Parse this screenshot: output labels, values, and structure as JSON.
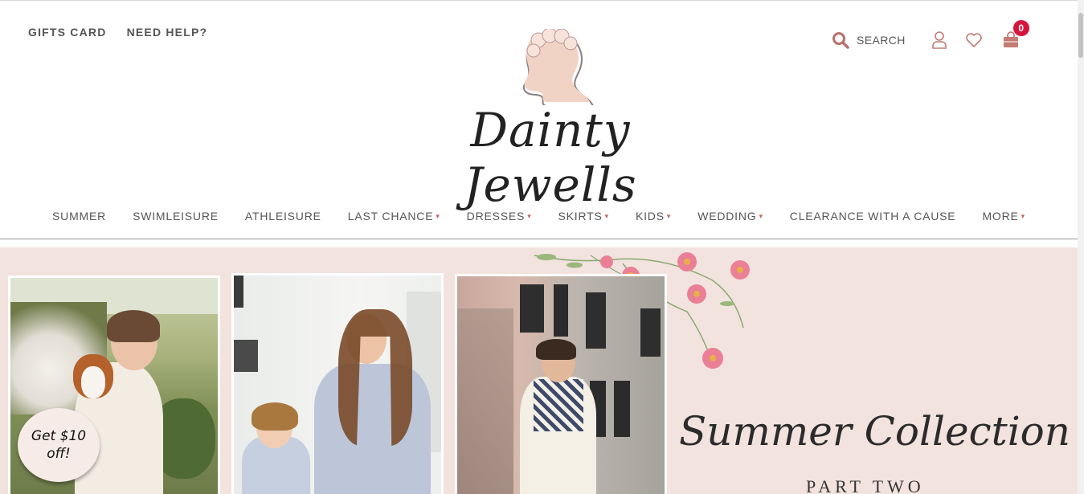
{
  "header": {
    "util_links": [
      "GIFTS CARD",
      "NEED HELP?"
    ],
    "logo_text": "Dainty Jewells",
    "search_label": "SEARCH",
    "cart_count": "0"
  },
  "nav": {
    "items": [
      {
        "label": "SUMMER",
        "dropdown": false
      },
      {
        "label": "SWIMLEISURE",
        "dropdown": false
      },
      {
        "label": "ATHLEISURE",
        "dropdown": false
      },
      {
        "label": "LAST CHANCE",
        "dropdown": true
      },
      {
        "label": "DRESSES",
        "dropdown": true
      },
      {
        "label": "SKIRTS",
        "dropdown": true
      },
      {
        "label": "KIDS",
        "dropdown": true
      },
      {
        "label": "WEDDING",
        "dropdown": true
      },
      {
        "label": "CLEARANCE WITH A CAUSE",
        "dropdown": false
      },
      {
        "label": "MORE",
        "dropdown": true
      }
    ],
    "caret_glyph": "▾"
  },
  "hero": {
    "title": "Summer Collection",
    "subtitle": "PART TWO"
  },
  "promo": {
    "line1": "Get $10",
    "line2": "off!"
  },
  "colors": {
    "accent": "#c06b6b",
    "badge": "#d6143c",
    "hero_bg": "#f2e3df"
  }
}
